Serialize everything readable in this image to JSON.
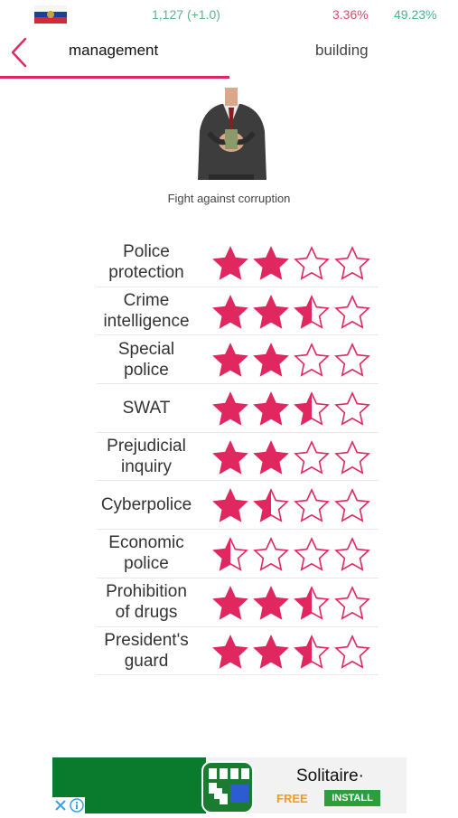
{
  "status": {
    "population": "1,127",
    "population_delta": "(+1.0)",
    "stat_red": "3.36%",
    "stat_green": "49.23%"
  },
  "header": {
    "tabs": [
      {
        "label": "management",
        "active": true
      },
      {
        "label": "building",
        "active": false
      }
    ]
  },
  "hero": {
    "caption": "Fight against corruption"
  },
  "items": [
    {
      "label": "Police protection",
      "rating": 2
    },
    {
      "label": "Crime intelligence",
      "rating": 2.5
    },
    {
      "label": "Special police",
      "rating": 2
    },
    {
      "label": "SWAT",
      "rating": 2.5
    },
    {
      "label": "Prejudicial inquiry",
      "rating": 2
    },
    {
      "label": "Cyberpolice",
      "rating": 1.5
    },
    {
      "label": "Economic police",
      "rating": 0.5
    },
    {
      "label": "Prohibition of drugs",
      "rating": 2.5
    },
    {
      "label": "President's guard",
      "rating": 2.5
    }
  ],
  "max_rating": 4,
  "ad": {
    "title": "Solitaire·",
    "free": "FREE",
    "install": "INSTALL"
  },
  "colors": {
    "accent": "#e0275f",
    "status_red": "#e24a6a",
    "status_green": "#47b58e"
  },
  "icons": [
    "flag-icon",
    "back-chevron-icon",
    "star-icon",
    "ad-close-icon",
    "ad-info-icon"
  ]
}
